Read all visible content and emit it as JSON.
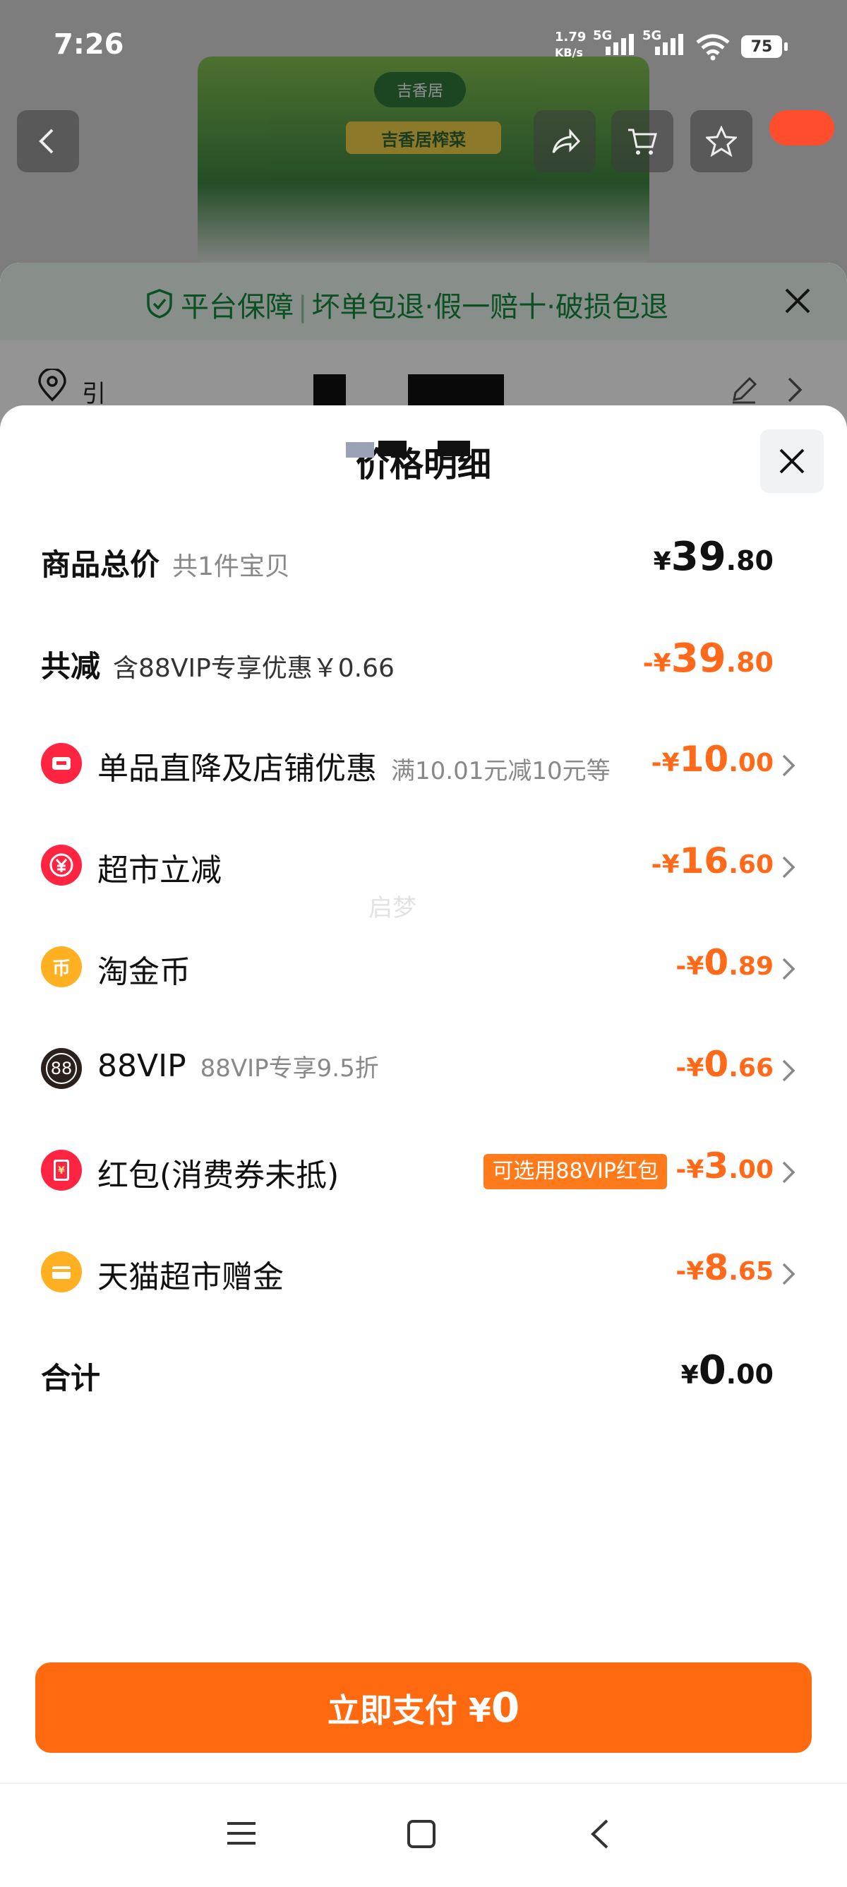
{
  "status_bar": {
    "time": "7:26",
    "net_speed_value": "1.79",
    "net_speed_unit": "KB/s",
    "sim1": "5G",
    "sim2": "5G",
    "battery": "75"
  },
  "background": {
    "product_brand": "吉香居",
    "product_name": "吉香居榨菜",
    "guarantee": {
      "prefix": "平台保障",
      "separator": "|",
      "items": "坏单包退·假一赔十·破损包退"
    },
    "address_name": "引"
  },
  "sheet": {
    "title": "价格明细",
    "total": {
      "label": "商品总价",
      "count_note": "共1件宝贝",
      "currency": "¥",
      "int": "39",
      "dec": ".80"
    },
    "reduction": {
      "label": "共减",
      "note": "含88VIP专享优惠￥0.66",
      "prefix": "-¥",
      "int": "39",
      "dec": ".80"
    },
    "items": [
      {
        "icon": "shop-coupon-icon",
        "name": "单品直降及店铺优惠",
        "note": "满10.01元减10元等",
        "prefix": "-¥",
        "int": "10",
        "dec": ".00",
        "color": "#ff2442"
      },
      {
        "icon": "supermarket-discount-icon",
        "name": "超市立减",
        "note": "",
        "prefix": "-¥",
        "int": "16",
        "dec": ".60",
        "color": "#ff2442"
      },
      {
        "icon": "taojinbi-coin-icon",
        "name": "淘金币",
        "note": "",
        "prefix": "-¥",
        "int": "0",
        "dec": ".89",
        "color": "#ffb020",
        "glyph": "币"
      },
      {
        "icon": "vip88-icon",
        "name": "88VIP",
        "note": "88VIP专享9.5折",
        "prefix": "-¥",
        "int": "0",
        "dec": ".66",
        "color": "#2a211c",
        "glyph": "88"
      },
      {
        "icon": "red-packet-icon",
        "name": "红包(消费券未抵)",
        "note": "",
        "tag": "可选用88VIP红包",
        "prefix": "-¥",
        "int": "3",
        "dec": ".00",
        "color": "#ff2442"
      },
      {
        "icon": "gift-money-icon",
        "name": "天猫超市赠金",
        "note": "",
        "prefix": "-¥",
        "int": "8",
        "dec": ".65",
        "color": "#ffb020"
      }
    ],
    "sum": {
      "label": "合计",
      "currency": "¥",
      "int": "0",
      "dec": ".00"
    },
    "watermark": "启梦",
    "pay_button": {
      "label": "立即支付",
      "currency": "¥",
      "amount": "0"
    }
  },
  "colors": {
    "accent_orange": "#ff6a10",
    "discount_orange": "#ff6a1a",
    "guarantee_green": "#148a3c"
  }
}
